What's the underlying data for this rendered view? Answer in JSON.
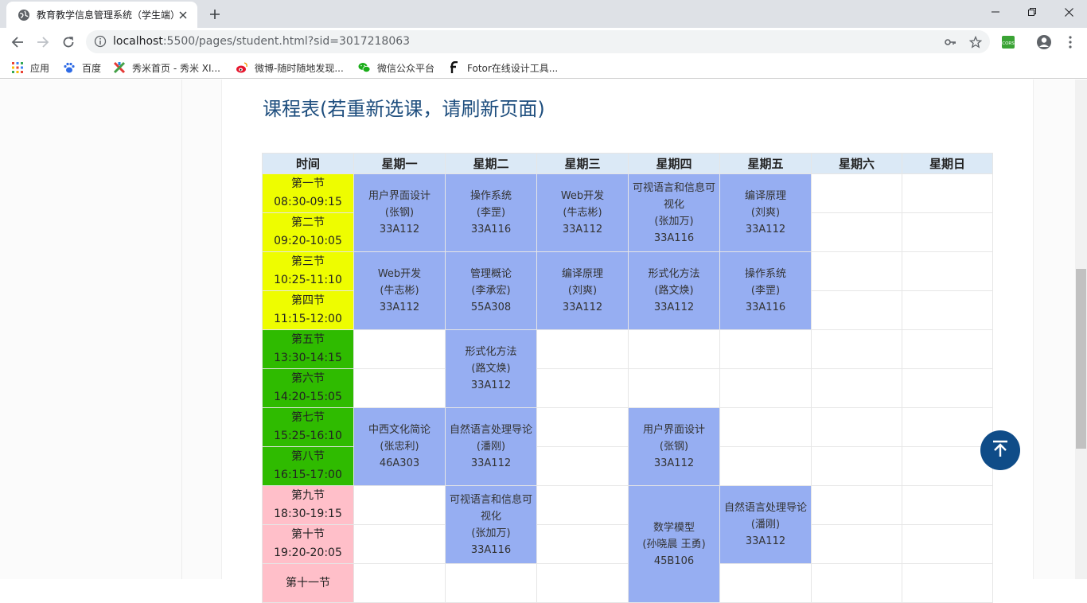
{
  "browser": {
    "tab_title": "教育教学信息管理系统（学生端）",
    "url_host": "localhost",
    "url_rest": ":5500/pages/student.html?sid=3017218063",
    "bookmarks": [
      {
        "label": "应用",
        "icon": "apps-grid-icon"
      },
      {
        "label": "百度",
        "icon": "baidu-paw-icon"
      },
      {
        "label": "秀米首页 - 秀米 XI...",
        "icon": "xiumi-icon"
      },
      {
        "label": "微博-随时随地发现...",
        "icon": "weibo-icon"
      },
      {
        "label": "微信公众平台",
        "icon": "wechat-icon"
      },
      {
        "label": "Fotor在线设计工具...",
        "icon": "fotor-icon"
      }
    ],
    "extension_label": "CORS"
  },
  "page": {
    "title": "课程表(若重新选课，请刷新页面)"
  },
  "schedule": {
    "headers": [
      "时间",
      "星期一",
      "星期二",
      "星期三",
      "星期四",
      "星期五",
      "星期六",
      "星期日"
    ],
    "periods": [
      {
        "name": "第一节",
        "time": "08:30-09:15",
        "session": "morning"
      },
      {
        "name": "第二节",
        "time": "09:20-10:05",
        "session": "morning"
      },
      {
        "name": "第三节",
        "time": "10:25-11:10",
        "session": "morning"
      },
      {
        "name": "第四节",
        "time": "11:15-12:00",
        "session": "morning"
      },
      {
        "name": "第五节",
        "time": "13:30-14:15",
        "session": "afternoon"
      },
      {
        "name": "第六节",
        "time": "14:20-15:05",
        "session": "afternoon"
      },
      {
        "name": "第七节",
        "time": "15:25-16:10",
        "session": "afternoon"
      },
      {
        "name": "第八节",
        "time": "16:15-17:00",
        "session": "afternoon"
      },
      {
        "name": "第九节",
        "time": "18:30-19:15",
        "session": "evening"
      },
      {
        "name": "第十节",
        "time": "19:20-20:05",
        "session": "evening"
      },
      {
        "name": "第十一节",
        "time": "",
        "session": "evening"
      }
    ],
    "courses": [
      {
        "day": 1,
        "start": 1,
        "span": 2,
        "name": "用户界面设计",
        "teacher": "(张钢)",
        "room": "33A112"
      },
      {
        "day": 2,
        "start": 1,
        "span": 2,
        "name": "操作系统",
        "teacher": "(李罡)",
        "room": "33A116"
      },
      {
        "day": 3,
        "start": 1,
        "span": 2,
        "name": "Web开发",
        "teacher": "(牛志彬)",
        "room": "33A112"
      },
      {
        "day": 4,
        "start": 1,
        "span": 2,
        "name": "可视语言和信息可视化",
        "teacher": "(张加万)",
        "room": "33A116"
      },
      {
        "day": 5,
        "start": 1,
        "span": 2,
        "name": "编译原理",
        "teacher": "(刘爽)",
        "room": "33A112"
      },
      {
        "day": 1,
        "start": 3,
        "span": 2,
        "name": "Web开发",
        "teacher": "(牛志彬)",
        "room": "33A112"
      },
      {
        "day": 2,
        "start": 3,
        "span": 2,
        "name": "管理概论",
        "teacher": "(李承宏)",
        "room": "55A308"
      },
      {
        "day": 3,
        "start": 3,
        "span": 2,
        "name": "编译原理",
        "teacher": "(刘爽)",
        "room": "33A112"
      },
      {
        "day": 4,
        "start": 3,
        "span": 2,
        "name": "形式化方法",
        "teacher": "(路文焕)",
        "room": "33A112"
      },
      {
        "day": 5,
        "start": 3,
        "span": 2,
        "name": "操作系统",
        "teacher": "(李罡)",
        "room": "33A116"
      },
      {
        "day": 2,
        "start": 5,
        "span": 2,
        "name": "形式化方法",
        "teacher": "(路文焕)",
        "room": "33A112"
      },
      {
        "day": 1,
        "start": 7,
        "span": 2,
        "name": "中西文化简论",
        "teacher": "(张忠利)",
        "room": "46A303"
      },
      {
        "day": 2,
        "start": 7,
        "span": 2,
        "name": "自然语言处理导论",
        "teacher": "(潘刚)",
        "room": "33A112"
      },
      {
        "day": 4,
        "start": 7,
        "span": 2,
        "name": "用户界面设计",
        "teacher": "(张钢)",
        "room": "33A112"
      },
      {
        "day": 2,
        "start": 9,
        "span": 2,
        "name": "可视语言和信息可视化",
        "teacher": "(张加万)",
        "room": "33A116"
      },
      {
        "day": 4,
        "start": 9,
        "span": 3,
        "name": "数学模型",
        "teacher": "(孙晓晨 王勇)",
        "room": "45B106"
      },
      {
        "day": 5,
        "start": 9,
        "span": 2,
        "name": "自然语言处理导论",
        "teacher": "(潘刚)",
        "room": "33A112"
      }
    ]
  },
  "colors": {
    "morning": "#eefd00",
    "afternoon": "#2fbb00",
    "evening": "#ffbfc9",
    "course": "#96aef2",
    "header": "#dbe9f6",
    "title": "#1e4e7e",
    "back_to_top": "#0f4c88"
  },
  "icons": {
    "back_to_top": "arrow-up-to-top-icon"
  }
}
